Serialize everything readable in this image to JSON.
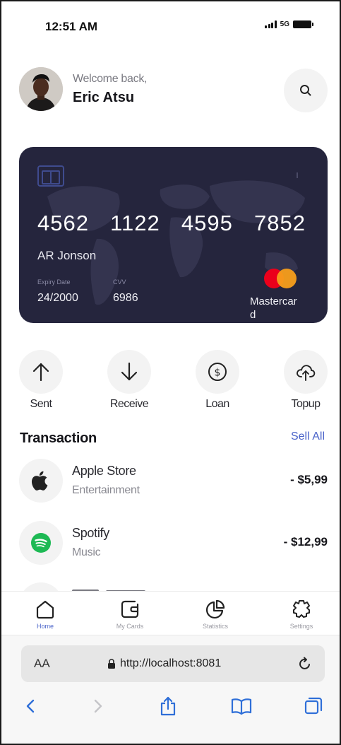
{
  "status_bar": {
    "time": "12:51 AM",
    "network": "5G"
  },
  "header": {
    "greeting": "Welcome back,",
    "user_name": "Eric Atsu"
  },
  "card": {
    "number_groups": [
      "4562",
      "1122",
      "4595",
      "7852"
    ],
    "holder": "AR Jonson",
    "expiry_label": "Expiry Date",
    "expiry_value": "24/2000",
    "cvv_label": "CVV",
    "cvv_value": "6986",
    "brand": "Mastercard",
    "background": "#25253d"
  },
  "actions": [
    {
      "label": "Sent",
      "icon": "arrow-up-icon"
    },
    {
      "label": "Receive",
      "icon": "arrow-down-icon"
    },
    {
      "label": "Loan",
      "icon": "dollar-coin-icon"
    },
    {
      "label": "Topup",
      "icon": "cloud-upload-icon"
    }
  ],
  "transactions": {
    "title": "Transaction",
    "see_all": "Sell All",
    "items": [
      {
        "name": "Apple Store",
        "category": "Entertainment",
        "amount": "- $5,99",
        "icon": "apple-icon"
      },
      {
        "name": "Spotify",
        "category": "Music",
        "amount": "- $12,99",
        "icon": "spotify-icon"
      }
    ]
  },
  "bottom_nav": {
    "items": [
      {
        "label": "Home",
        "icon": "home-icon",
        "active": true
      },
      {
        "label": "My Cards",
        "icon": "card-icon",
        "active": false
      },
      {
        "label": "Statistics",
        "icon": "pie-chart-icon",
        "active": false
      },
      {
        "label": "Settings",
        "icon": "settings-icon",
        "active": false
      }
    ],
    "accent": "#4a63c9"
  },
  "browser": {
    "aa_label": "AA",
    "url": "http://localhost:8081"
  }
}
